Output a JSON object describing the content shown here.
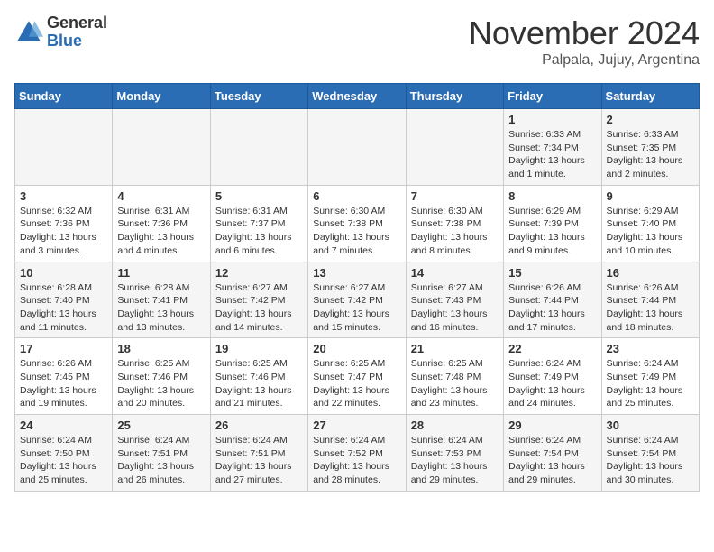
{
  "header": {
    "logo_general": "General",
    "logo_blue": "Blue",
    "month_title": "November 2024",
    "location": "Palpala, Jujuy, Argentina"
  },
  "days_of_week": [
    "Sunday",
    "Monday",
    "Tuesday",
    "Wednesday",
    "Thursday",
    "Friday",
    "Saturday"
  ],
  "weeks": [
    [
      {
        "day": "",
        "details": ""
      },
      {
        "day": "",
        "details": ""
      },
      {
        "day": "",
        "details": ""
      },
      {
        "day": "",
        "details": ""
      },
      {
        "day": "",
        "details": ""
      },
      {
        "day": "1",
        "details": "Sunrise: 6:33 AM\nSunset: 7:34 PM\nDaylight: 13 hours and 1 minute."
      },
      {
        "day": "2",
        "details": "Sunrise: 6:33 AM\nSunset: 7:35 PM\nDaylight: 13 hours and 2 minutes."
      }
    ],
    [
      {
        "day": "3",
        "details": "Sunrise: 6:32 AM\nSunset: 7:36 PM\nDaylight: 13 hours and 3 minutes."
      },
      {
        "day": "4",
        "details": "Sunrise: 6:31 AM\nSunset: 7:36 PM\nDaylight: 13 hours and 4 minutes."
      },
      {
        "day": "5",
        "details": "Sunrise: 6:31 AM\nSunset: 7:37 PM\nDaylight: 13 hours and 6 minutes."
      },
      {
        "day": "6",
        "details": "Sunrise: 6:30 AM\nSunset: 7:38 PM\nDaylight: 13 hours and 7 minutes."
      },
      {
        "day": "7",
        "details": "Sunrise: 6:30 AM\nSunset: 7:38 PM\nDaylight: 13 hours and 8 minutes."
      },
      {
        "day": "8",
        "details": "Sunrise: 6:29 AM\nSunset: 7:39 PM\nDaylight: 13 hours and 9 minutes."
      },
      {
        "day": "9",
        "details": "Sunrise: 6:29 AM\nSunset: 7:40 PM\nDaylight: 13 hours and 10 minutes."
      }
    ],
    [
      {
        "day": "10",
        "details": "Sunrise: 6:28 AM\nSunset: 7:40 PM\nDaylight: 13 hours and 11 minutes."
      },
      {
        "day": "11",
        "details": "Sunrise: 6:28 AM\nSunset: 7:41 PM\nDaylight: 13 hours and 13 minutes."
      },
      {
        "day": "12",
        "details": "Sunrise: 6:27 AM\nSunset: 7:42 PM\nDaylight: 13 hours and 14 minutes."
      },
      {
        "day": "13",
        "details": "Sunrise: 6:27 AM\nSunset: 7:42 PM\nDaylight: 13 hours and 15 minutes."
      },
      {
        "day": "14",
        "details": "Sunrise: 6:27 AM\nSunset: 7:43 PM\nDaylight: 13 hours and 16 minutes."
      },
      {
        "day": "15",
        "details": "Sunrise: 6:26 AM\nSunset: 7:44 PM\nDaylight: 13 hours and 17 minutes."
      },
      {
        "day": "16",
        "details": "Sunrise: 6:26 AM\nSunset: 7:44 PM\nDaylight: 13 hours and 18 minutes."
      }
    ],
    [
      {
        "day": "17",
        "details": "Sunrise: 6:26 AM\nSunset: 7:45 PM\nDaylight: 13 hours and 19 minutes."
      },
      {
        "day": "18",
        "details": "Sunrise: 6:25 AM\nSunset: 7:46 PM\nDaylight: 13 hours and 20 minutes."
      },
      {
        "day": "19",
        "details": "Sunrise: 6:25 AM\nSunset: 7:46 PM\nDaylight: 13 hours and 21 minutes."
      },
      {
        "day": "20",
        "details": "Sunrise: 6:25 AM\nSunset: 7:47 PM\nDaylight: 13 hours and 22 minutes."
      },
      {
        "day": "21",
        "details": "Sunrise: 6:25 AM\nSunset: 7:48 PM\nDaylight: 13 hours and 23 minutes."
      },
      {
        "day": "22",
        "details": "Sunrise: 6:24 AM\nSunset: 7:49 PM\nDaylight: 13 hours and 24 minutes."
      },
      {
        "day": "23",
        "details": "Sunrise: 6:24 AM\nSunset: 7:49 PM\nDaylight: 13 hours and 25 minutes."
      }
    ],
    [
      {
        "day": "24",
        "details": "Sunrise: 6:24 AM\nSunset: 7:50 PM\nDaylight: 13 hours and 25 minutes."
      },
      {
        "day": "25",
        "details": "Sunrise: 6:24 AM\nSunset: 7:51 PM\nDaylight: 13 hours and 26 minutes."
      },
      {
        "day": "26",
        "details": "Sunrise: 6:24 AM\nSunset: 7:51 PM\nDaylight: 13 hours and 27 minutes."
      },
      {
        "day": "27",
        "details": "Sunrise: 6:24 AM\nSunset: 7:52 PM\nDaylight: 13 hours and 28 minutes."
      },
      {
        "day": "28",
        "details": "Sunrise: 6:24 AM\nSunset: 7:53 PM\nDaylight: 13 hours and 29 minutes."
      },
      {
        "day": "29",
        "details": "Sunrise: 6:24 AM\nSunset: 7:54 PM\nDaylight: 13 hours and 29 minutes."
      },
      {
        "day": "30",
        "details": "Sunrise: 6:24 AM\nSunset: 7:54 PM\nDaylight: 13 hours and 30 minutes."
      }
    ]
  ]
}
